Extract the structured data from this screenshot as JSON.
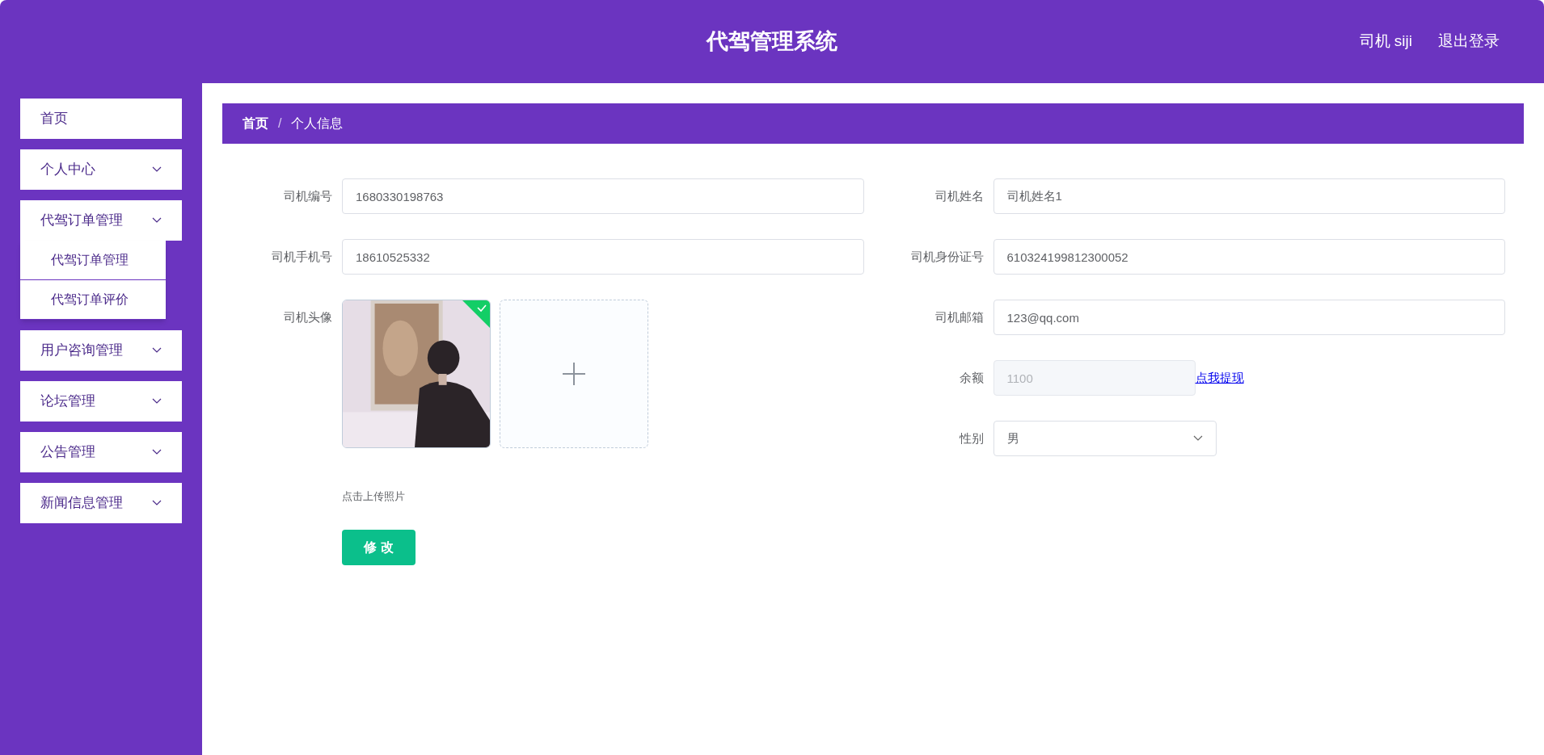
{
  "header": {
    "title": "代驾管理系统",
    "user": "司机 siji",
    "logout": "退出登录"
  },
  "sidebar": {
    "items": [
      {
        "label": "首页",
        "kind": "link"
      },
      {
        "label": "个人中心",
        "kind": "menu"
      },
      {
        "label": "代驾订单管理",
        "kind": "menu",
        "children": [
          {
            "label": "代驾订单管理"
          },
          {
            "label": "代驾订单评价"
          }
        ]
      },
      {
        "label": "用户咨询管理",
        "kind": "menu"
      },
      {
        "label": "论坛管理",
        "kind": "menu"
      },
      {
        "label": "公告管理",
        "kind": "menu"
      },
      {
        "label": "新闻信息管理",
        "kind": "menu"
      }
    ]
  },
  "breadcrumb": [
    "首页",
    "个人信息"
  ],
  "breadcrumb_separator": "/",
  "form": {
    "left": [
      {
        "kind": "text",
        "label": "司机编号",
        "value": "1680330198763"
      },
      {
        "kind": "text",
        "label": "司机手机号",
        "value": "18610525332"
      },
      {
        "kind": "upload",
        "label": "司机头像",
        "uploaded": true,
        "hint": "点击上传照片"
      }
    ],
    "right": [
      {
        "kind": "text",
        "label": "司机姓名",
        "value": "司机姓名1"
      },
      {
        "kind": "text",
        "label": "司机身份证号",
        "value": "610324199812300052"
      },
      {
        "kind": "text",
        "label": "司机邮箱",
        "value": "123@qq.com"
      },
      {
        "kind": "disabled",
        "label": "余额",
        "value": "1100",
        "link": "点我提现"
      },
      {
        "kind": "select",
        "label": "性别",
        "value": "男"
      }
    ],
    "submit": "修 改"
  }
}
